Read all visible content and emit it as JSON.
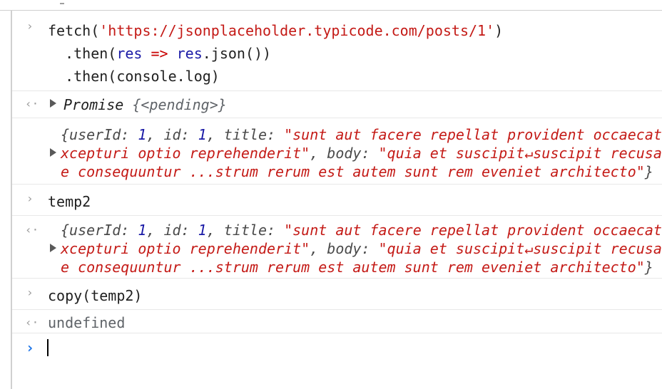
{
  "entries": [
    {
      "kind": "input",
      "lines": [
        [
          "fetch(",
          "'https://jsonplaceholder.typicode.com/posts/1'",
          ")"
        ],
        [
          "  .then(",
          "res",
          " ",
          "=>",
          " ",
          "res",
          ".json())"
        ],
        [
          "  .then(console.log)"
        ]
      ]
    },
    {
      "kind": "result",
      "text_label": "Promise",
      "text_value": "{<pending>}"
    },
    {
      "kind": "log",
      "lines": [
        [
          "{userId: ",
          "1",
          ", id: ",
          "1",
          ", title: ",
          "\"sunt aut facere repellat provident occaecati e"
        ],
        [
          "xcepturi optio reprehenderit\"",
          ", body: ",
          "\"quia et suscipit↵suscipit recusanda"
        ],
        [
          "e consequuntur ...strum rerum est autem sunt rem eveniet architecto\"",
          "}"
        ]
      ]
    },
    {
      "kind": "input",
      "text": "temp2"
    },
    {
      "kind": "result",
      "lines": [
        [
          "{userId: ",
          "1",
          ", id: ",
          "1",
          ", title: ",
          "\"sunt aut facere repellat provident occaecati e"
        ],
        [
          "xcepturi optio reprehenderit\"",
          ", body: ",
          "\"quia et suscipit↵suscipit recusanda"
        ],
        [
          "e consequuntur ...strum rerum est autem sunt rem eveniet architecto\"",
          "}"
        ]
      ]
    },
    {
      "kind": "input",
      "text": "copy(temp2)"
    },
    {
      "kind": "result",
      "text": "undefined"
    }
  ],
  "markers": {
    "input": "›",
    "result": "‹·"
  },
  "colors": {
    "string": "#c41a16",
    "keyword": "#1a1aa6",
    "number": "#1a1aa6",
    "prompt": "#1a73e8"
  }
}
